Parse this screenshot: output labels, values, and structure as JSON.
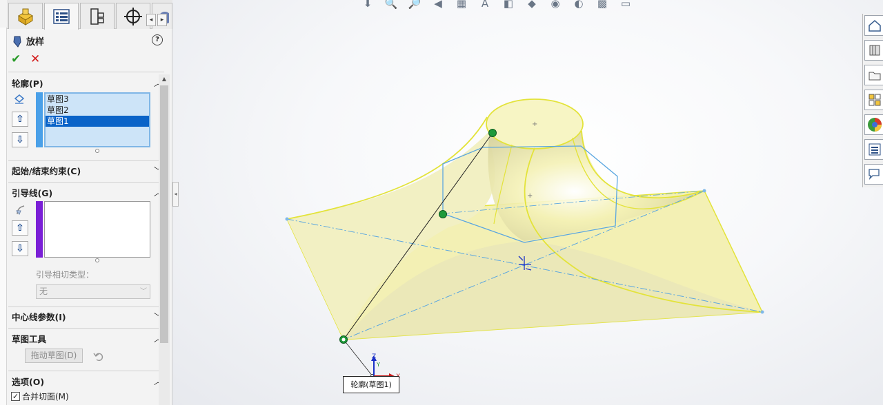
{
  "property_manager": {
    "tabs": [
      {
        "icon": "feature-manager-icon"
      },
      {
        "icon": "property-manager-icon"
      },
      {
        "icon": "configuration-manager-icon"
      },
      {
        "icon": "dimxpert-manager-icon"
      },
      {
        "icon": "display-manager-icon"
      }
    ],
    "feature_name": "放样",
    "profiles": {
      "header": "轮廓(P)",
      "items": [
        "草图3",
        "草图2",
        "草图1"
      ],
      "selected_index": 2
    },
    "start_end": {
      "header": "起始/结束约束(C)"
    },
    "guides": {
      "header": "引导线(G)",
      "tangency_label": "引导相切类型：",
      "tangency_value": "无"
    },
    "centerline": {
      "header": "中心线参数(I)"
    },
    "sketch_tools": {
      "header": "草图工具",
      "drag_button": "拖动草图(D)"
    },
    "options": {
      "header": "选项(O)",
      "merge_faces_label": "合并切面(M)",
      "merge_faces_checked": true
    }
  },
  "viewport": {
    "callout_label": "轮廓(草图1)",
    "triad": {
      "x": "X",
      "y": "Y",
      "z": "Z"
    },
    "right_toolbar": [
      {
        "icon": "home-icon"
      },
      {
        "icon": "parts-library-icon"
      },
      {
        "icon": "file-explorer-icon"
      },
      {
        "icon": "view-palette-icon"
      },
      {
        "icon": "appearances-icon"
      },
      {
        "icon": "custom-properties-icon"
      },
      {
        "icon": "forum-icon"
      }
    ],
    "top_toolbar": [
      {
        "icon": "view-orientation-icon"
      },
      {
        "icon": "zoom-fit-icon"
      },
      {
        "icon": "zoom-area-icon"
      },
      {
        "icon": "previous-view-icon"
      },
      {
        "icon": "section-view-icon"
      },
      {
        "icon": "dynamic-annotation-icon"
      },
      {
        "icon": "display-style-icon"
      },
      {
        "icon": "hide-show-icon"
      },
      {
        "icon": "edit-appearance-icon"
      },
      {
        "icon": "apply-scene-icon"
      },
      {
        "icon": "view-settings-icon"
      },
      {
        "icon": "monitor-icon"
      }
    ]
  },
  "colors": {
    "surface_fill": "#f2f0a6",
    "edge_yellow": "#e6e63a",
    "sketch_blue": "#5aa6e0",
    "selection_blue": "#0a63c8",
    "guide_purple": "#7a1fd6"
  }
}
